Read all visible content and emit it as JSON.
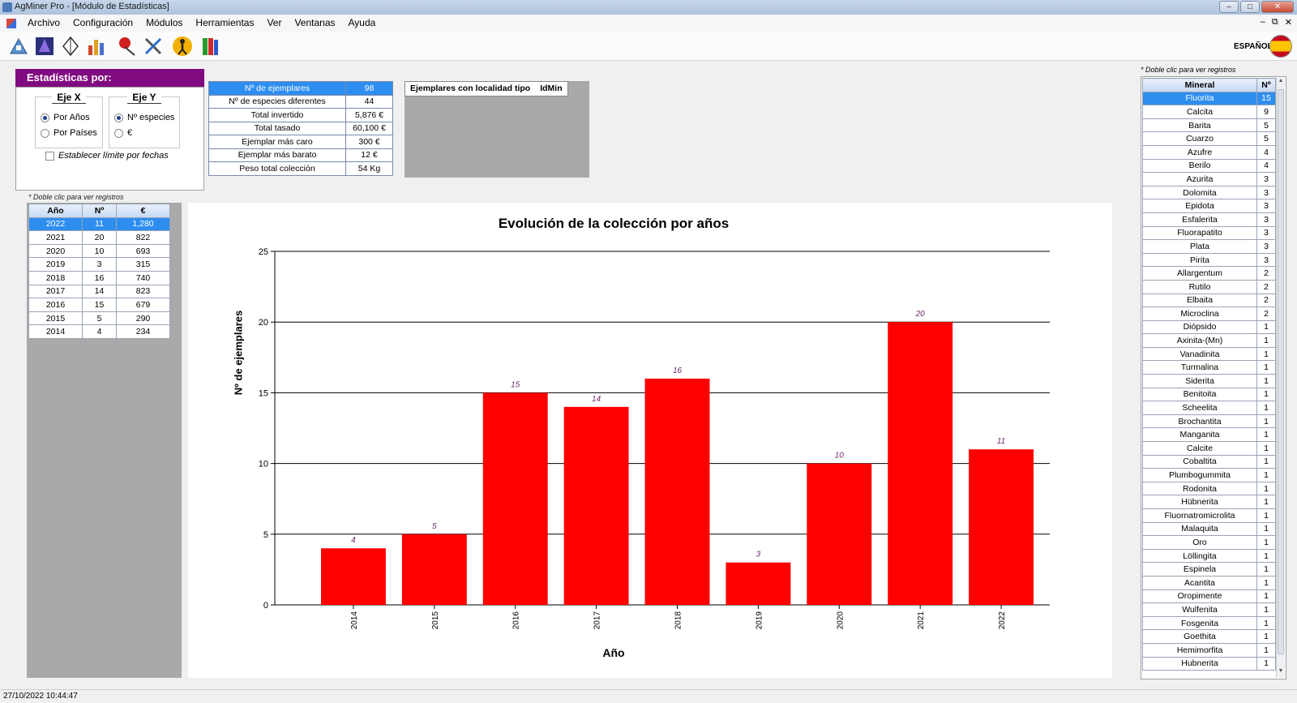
{
  "window": {
    "title": "AgMiner Pro - [Módulo de Estadísticas]"
  },
  "menu": [
    "Archivo",
    "Configuración",
    "Módulos",
    "Herramientas",
    "Ver",
    "Ventanas",
    "Ayuda"
  ],
  "toolbar": {
    "icons": [
      "tool-a-icon",
      "mineral-crystal-icon",
      "diamond-icon",
      "bar-stats-icon",
      "pin-location-icon",
      "tools-icon",
      "hiker-icon",
      "books-icon"
    ],
    "language": "ESPAÑOL"
  },
  "stats_panel": {
    "header": "Estadísticas por:",
    "eje_x": {
      "title": "Eje X",
      "options": [
        "Por Años",
        "Por Países"
      ],
      "selected": 0
    },
    "eje_y": {
      "title": "Eje Y",
      "options": [
        "Nº especies",
        "€"
      ],
      "selected": 0
    },
    "limit_label": "Establecer límite por fechas",
    "limit_checked": false
  },
  "summary": [
    {
      "label": "Nº de ejemplares",
      "value": "98"
    },
    {
      "label": "Nº de especies diferentes",
      "value": "44"
    },
    {
      "label": "Total invertido",
      "value": "5,876 €"
    },
    {
      "label": "Total tasado",
      "value": "60,100 €"
    },
    {
      "label": "Ejemplar más caro",
      "value": "300 €"
    },
    {
      "label": "Ejemplar más barato",
      "value": "12 €"
    },
    {
      "label": "Peso total colección",
      "value": "54 Kg"
    }
  ],
  "ejemplares_box": {
    "col1": "Ejemplares con localidad tipo",
    "col2": "IdMin"
  },
  "hint": "* Doble clic para ver registros",
  "year_table": {
    "headers": [
      "Año",
      "Nº",
      "€"
    ],
    "rows": [
      [
        "2022",
        "11",
        "1,280"
      ],
      [
        "2021",
        "20",
        "822"
      ],
      [
        "2020",
        "10",
        "693"
      ],
      [
        "2019",
        "3",
        "315"
      ],
      [
        "2018",
        "16",
        "740"
      ],
      [
        "2017",
        "14",
        "823"
      ],
      [
        "2016",
        "15",
        "679"
      ],
      [
        "2015",
        "5",
        "290"
      ],
      [
        "2014",
        "4",
        "234"
      ]
    ],
    "selected_row": 0
  },
  "chart_data": {
    "type": "bar",
    "title": "Evolución de la colección por años",
    "xlabel": "Año",
    "ylabel": "Nº de ejemplares",
    "categories": [
      "2014",
      "2015",
      "2016",
      "2017",
      "2018",
      "2019",
      "2020",
      "2021",
      "2022"
    ],
    "values": [
      4,
      5,
      15,
      14,
      16,
      3,
      10,
      20,
      11
    ],
    "yticks": [
      0,
      5,
      10,
      15,
      20,
      25
    ],
    "ylim": [
      0,
      25
    ],
    "bar_color": "#ff0000",
    "label_color": "#6b2a6b",
    "grid": true
  },
  "mineral_table": {
    "headers": [
      "Mineral",
      "Nº"
    ],
    "rows": [
      [
        "Fluorita",
        "15"
      ],
      [
        "Calcita",
        "9"
      ],
      [
        "Barita",
        "5"
      ],
      [
        "Cuarzo",
        "5"
      ],
      [
        "Azufre",
        "4"
      ],
      [
        "Berilo",
        "4"
      ],
      [
        "Azurita",
        "3"
      ],
      [
        "Dolomita",
        "3"
      ],
      [
        "Epidota",
        "3"
      ],
      [
        "Esfalerita",
        "3"
      ],
      [
        "Fluorapatito",
        "3"
      ],
      [
        "Plata",
        "3"
      ],
      [
        "Pirita",
        "3"
      ],
      [
        "Allargentum",
        "2"
      ],
      [
        "Rutilo",
        "2"
      ],
      [
        "Elbaita",
        "2"
      ],
      [
        "Microclina",
        "2"
      ],
      [
        "Diópsido",
        "1"
      ],
      [
        "Axinita-(Mn)",
        "1"
      ],
      [
        "Vanadinita",
        "1"
      ],
      [
        "Turmalina",
        "1"
      ],
      [
        "Siderita",
        "1"
      ],
      [
        "Benitoita",
        "1"
      ],
      [
        "Scheelita",
        "1"
      ],
      [
        "Brochantita",
        "1"
      ],
      [
        "Manganita",
        "1"
      ],
      [
        "Calcite",
        "1"
      ],
      [
        "Cobaltita",
        "1"
      ],
      [
        "Plumbogummita",
        "1"
      ],
      [
        "Rodonita",
        "1"
      ],
      [
        "Hübnerita",
        "1"
      ],
      [
        "Fluornatromicrolita",
        "1"
      ],
      [
        "Malaquita",
        "1"
      ],
      [
        "Oro",
        "1"
      ],
      [
        "Löllingita",
        "1"
      ],
      [
        "Espinela",
        "1"
      ],
      [
        "Acantita",
        "1"
      ],
      [
        "Oropimente",
        "1"
      ],
      [
        "Wulfenita",
        "1"
      ],
      [
        "Fosgenita",
        "1"
      ],
      [
        "Goethita",
        "1"
      ],
      [
        "Hemimorfita",
        "1"
      ],
      [
        "Hubnerita",
        "1"
      ]
    ],
    "selected_row": 0
  },
  "status": {
    "datetime": "27/10/2022 10:44:47"
  }
}
